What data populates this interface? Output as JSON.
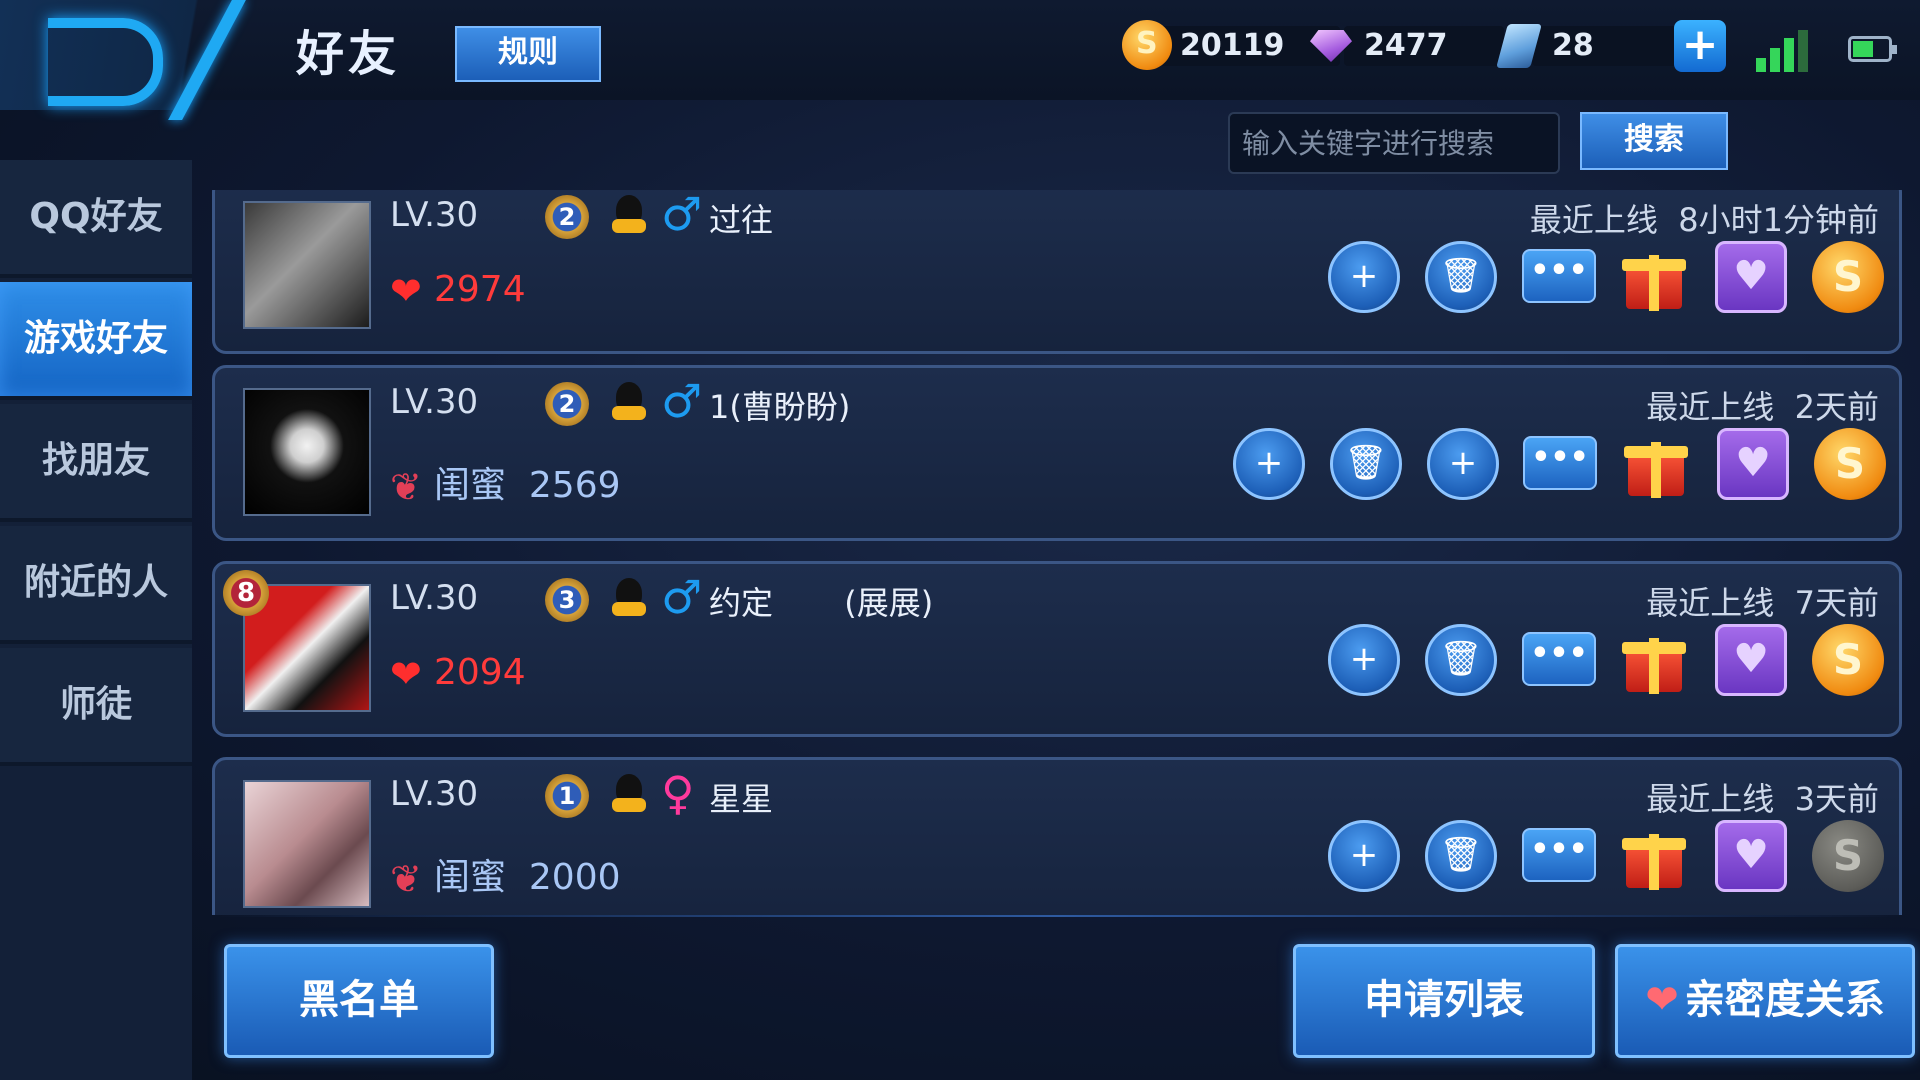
{
  "header": {
    "title": "好友",
    "rules_label": "规则",
    "gold": "20119",
    "diamonds": "2477",
    "tickets": "28",
    "plus_icon": "+"
  },
  "nav": {
    "items": [
      {
        "label": "QQ好友"
      },
      {
        "label": "游戏好友"
      },
      {
        "label": "找朋友"
      },
      {
        "label": "附近的人"
      },
      {
        "label": "师徒"
      }
    ],
    "active_index": 1
  },
  "search": {
    "placeholder": "输入关键字进行搜索",
    "button_label": "搜索"
  },
  "friends": [
    {
      "level": "LV.30",
      "rank": "2",
      "gender": "male",
      "gender_symbol": "♂",
      "name": "过往",
      "last_online": "最近上线  8小时1分钟前",
      "intimacy_icon": "heart",
      "relation": "",
      "intimacy": "2974"
    },
    {
      "level": "LV.30",
      "rank": "2",
      "gender": "male",
      "gender_symbol": "♂",
      "name": "1(曹盼盼)",
      "last_online": "最近上线  2天前",
      "intimacy_icon": "lips",
      "relation": "闺蜜",
      "intimacy": "2569"
    },
    {
      "level": "LV.30",
      "rank": "3",
      "gender": "male",
      "gender_symbol": "♂",
      "name": "约定       (展展)",
      "last_online": "最近上线  7天前",
      "intimacy_icon": "heart",
      "relation": "",
      "intimacy": "2094",
      "avatar_badge": "8"
    },
    {
      "level": "LV.30",
      "rank": "1",
      "gender": "female",
      "gender_symbol": "♀",
      "name": "星星",
      "last_online": "最近上线  3天前",
      "intimacy_icon": "lips",
      "relation": "闺蜜",
      "intimacy": "2000"
    }
  ],
  "action_icons": {
    "add": "+",
    "delete": "🗑",
    "chat": "•••",
    "heart": "♥",
    "coin": "S"
  },
  "bottom": {
    "blacklist": "黑名单",
    "requests": "申请列表",
    "intimacy_relations": "亲密度关系"
  },
  "colors": {
    "accent": "#1fa9f3",
    "button_blue": "#1c5fb8",
    "intimacy_red": "#ff3b3b",
    "male": "#1d9bf0",
    "female": "#ff3a9c"
  }
}
